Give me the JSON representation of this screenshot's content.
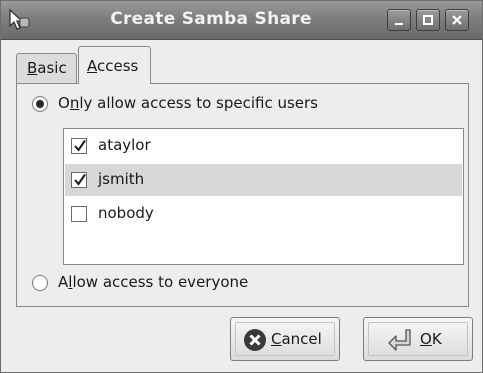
{
  "window": {
    "title": "Create Samba Share",
    "controls": [
      "minimize",
      "maximize",
      "close"
    ]
  },
  "tabs": [
    {
      "label": "Basic",
      "mnemonic": "B",
      "rest": "asic",
      "active": false
    },
    {
      "label": "Access",
      "mnemonic": "A",
      "rest": "ccess",
      "active": true
    }
  ],
  "access": {
    "specific": {
      "pre": "O",
      "mnemonic": "n",
      "post": "ly allow access to specific users",
      "checked": true
    },
    "everyone": {
      "pre": "A",
      "mnemonic": "l",
      "post": "low access to everyone",
      "checked": false
    }
  },
  "users": [
    {
      "name": "ataylor",
      "checked": true,
      "selected": false
    },
    {
      "name": "jsmith",
      "checked": true,
      "selected": true
    },
    {
      "name": "nobody",
      "checked": false,
      "selected": false
    }
  ],
  "buttons": {
    "cancel": {
      "mnemonic": "C",
      "rest": "ancel",
      "label": "Cancel"
    },
    "ok": {
      "mnemonic": "O",
      "rest": "K",
      "label": "OK"
    }
  },
  "icons": {
    "app": "samba-share-app-icon",
    "cancel": "cancel-icon",
    "ok": "ok-return-icon"
  }
}
